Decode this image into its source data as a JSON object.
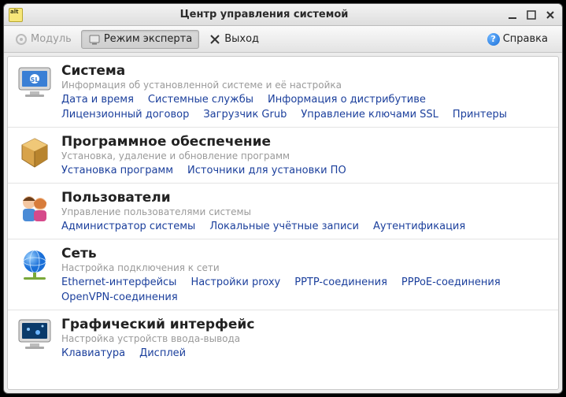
{
  "window": {
    "title": "Центр управления системой"
  },
  "toolbar": {
    "module": "Модуль",
    "expert_mode": "Режим эксперта",
    "exit": "Выход",
    "help": "Справка"
  },
  "sections": [
    {
      "title": "Система",
      "desc": "Информация об установленной системе и её настройка",
      "links": [
        "Дата и время",
        "Системные службы",
        "Информация о дистрибутиве",
        "Лицензионный договор",
        "Загрузчик Grub",
        "Управление ключами SSL",
        "Принтеры"
      ]
    },
    {
      "title": "Программное обеспечение",
      "desc": "Установка, удаление и обновление программ",
      "links": [
        "Установка программ",
        "Источники для установки ПО"
      ]
    },
    {
      "title": "Пользователи",
      "desc": "Управление пользователями системы",
      "links": [
        "Администратор системы",
        "Локальные учётные записи",
        "Аутентификация"
      ]
    },
    {
      "title": "Сеть",
      "desc": "Настройка подключения к сети",
      "links": [
        "Ethernet-интерфейсы",
        "Настройки proxy",
        "PPTP-соединения",
        "PPPoE-соединения",
        "OpenVPN-соединения"
      ]
    },
    {
      "title": "Графический интерфейс",
      "desc": "Настройка устройств ввода-вывода",
      "links": [
        "Клавиатура",
        "Дисплей"
      ]
    }
  ]
}
